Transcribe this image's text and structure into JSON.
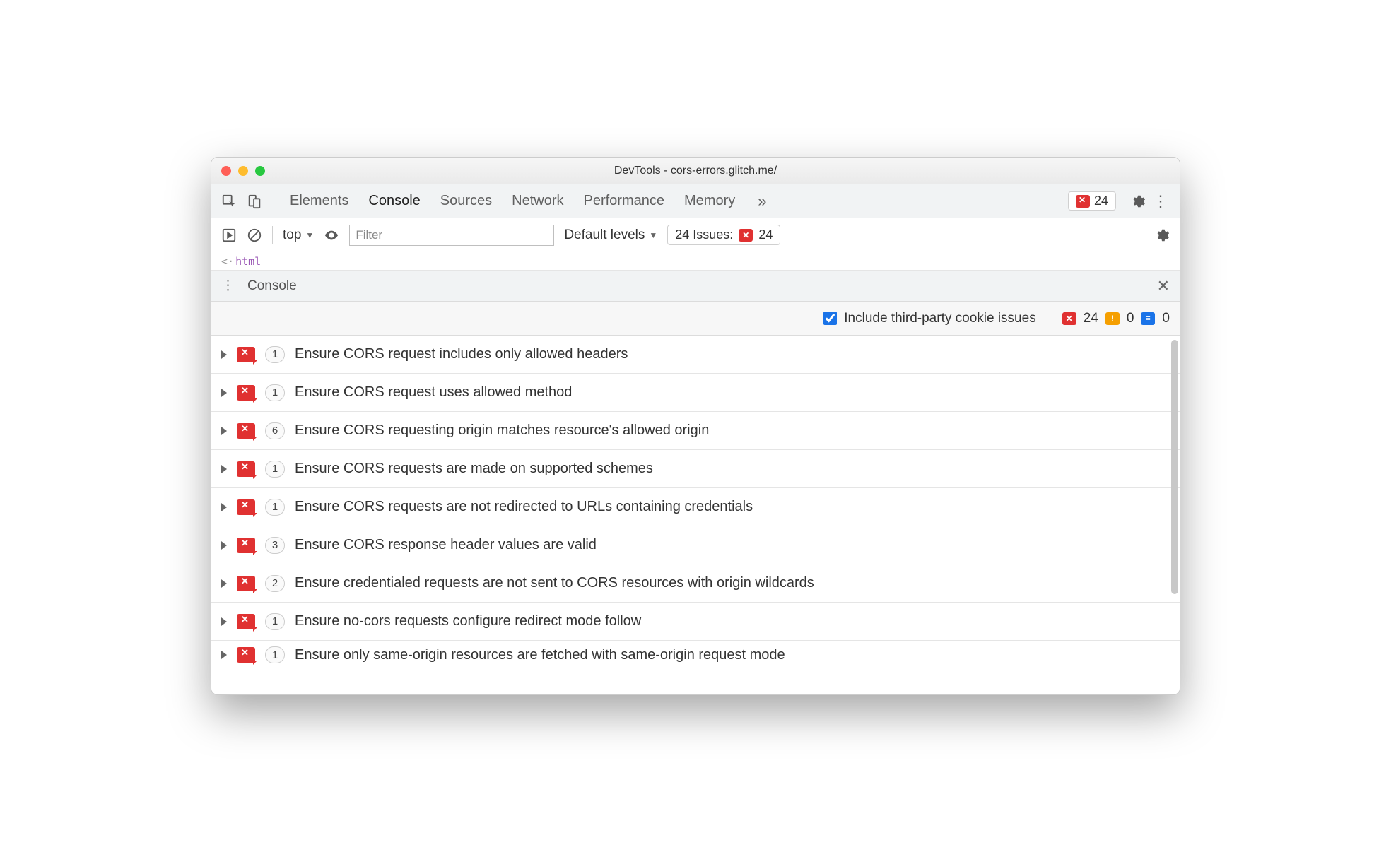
{
  "window": {
    "title": "DevTools - cors-errors.glitch.me/"
  },
  "tabs": {
    "items": [
      "Elements",
      "Console",
      "Sources",
      "Network",
      "Performance",
      "Memory"
    ],
    "active": "Console",
    "overflow": true,
    "error_count": "24"
  },
  "console_toolbar": {
    "context": "top",
    "filter_placeholder": "Filter",
    "levels_label": "Default levels",
    "issues_label": "24 Issues:",
    "issues_count": "24"
  },
  "source_hint": "html",
  "drawer": {
    "title": "Console"
  },
  "issues_filter": {
    "checkbox_label": "Include third-party cookie issues",
    "checkbox_checked": true,
    "errors": "24",
    "warnings": "0",
    "info": "0"
  },
  "issues": [
    {
      "count": "1",
      "text": "Ensure CORS request includes only allowed headers"
    },
    {
      "count": "1",
      "text": "Ensure CORS request uses allowed method"
    },
    {
      "count": "6",
      "text": "Ensure CORS requesting origin matches resource's allowed origin"
    },
    {
      "count": "1",
      "text": "Ensure CORS requests are made on supported schemes"
    },
    {
      "count": "1",
      "text": "Ensure CORS requests are not redirected to URLs containing credentials"
    },
    {
      "count": "3",
      "text": "Ensure CORS response header values are valid"
    },
    {
      "count": "2",
      "text": "Ensure credentialed requests are not sent to CORS resources with origin wildcards"
    },
    {
      "count": "1",
      "text": "Ensure no-cors requests configure redirect mode follow"
    },
    {
      "count": "1",
      "text": "Ensure only same-origin resources are fetched with same-origin request mode"
    }
  ]
}
